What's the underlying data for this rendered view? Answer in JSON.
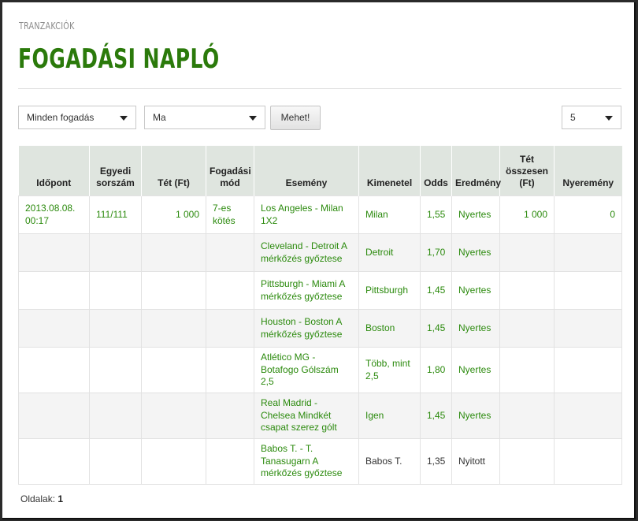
{
  "section_label": "TRANZAKCIÓK",
  "title": "FOGADÁSI NAPLÓ",
  "filters": {
    "bet_type": "Minden fogadás",
    "period": "Ma",
    "go_button": "Mehet!",
    "page_size": "5"
  },
  "table": {
    "headers": [
      "Időpont",
      "Egyedi sorszám",
      "Tét (Ft)",
      "Fogadási mód",
      "Esemény",
      "Kimenetel",
      "Odds",
      "Eredmény",
      "Tét összesen (Ft)",
      "Nyeremény"
    ],
    "rows": [
      {
        "time": "2013.08.08. 00:17",
        "serial": "111/111",
        "stake": "1 000",
        "mode": "7-es kötés",
        "event": "Los Angeles - Milan 1X2",
        "outcome": "Milan",
        "odds": "1,55",
        "result": "Nyertes",
        "total": "1 000",
        "win": "0"
      },
      {
        "time": "",
        "serial": "",
        "stake": "",
        "mode": "",
        "event": "Cleveland - Detroit A mérkőzés győztese",
        "outcome": "Detroit",
        "odds": "1,70",
        "result": "Nyertes",
        "total": "",
        "win": ""
      },
      {
        "time": "",
        "serial": "",
        "stake": "",
        "mode": "",
        "event": "Pittsburgh - Miami A mérkőzés győztese",
        "outcome": "Pittsburgh",
        "odds": "1,45",
        "result": "Nyertes",
        "total": "",
        "win": ""
      },
      {
        "time": "",
        "serial": "",
        "stake": "",
        "mode": "",
        "event": "Houston - Boston A mérkőzés győztese",
        "outcome": "Boston",
        "odds": "1,45",
        "result": "Nyertes",
        "total": "",
        "win": ""
      },
      {
        "time": "",
        "serial": "",
        "stake": "",
        "mode": "",
        "event": "Atlético MG - Botafogo Gólszám 2,5",
        "outcome": "Több, mint 2,5",
        "odds": "1,80",
        "result": "Nyertes",
        "total": "",
        "win": ""
      },
      {
        "time": "",
        "serial": "",
        "stake": "",
        "mode": "",
        "event": "Real Madrid - Chelsea Mindkét csapat szerez gólt",
        "outcome": "Igen",
        "odds": "1,45",
        "result": "Nyertes",
        "total": "",
        "win": ""
      },
      {
        "time": "",
        "serial": "",
        "stake": "",
        "mode": "",
        "event": "Babos T. - T. Tanasugarn A mérkőzés győztese",
        "outcome": "Babos T.",
        "odds": "1,35",
        "result": "Nyitott",
        "total": "",
        "win": "",
        "open": true
      }
    ]
  },
  "footer": {
    "label": "Oldalak:",
    "page": "1"
  }
}
